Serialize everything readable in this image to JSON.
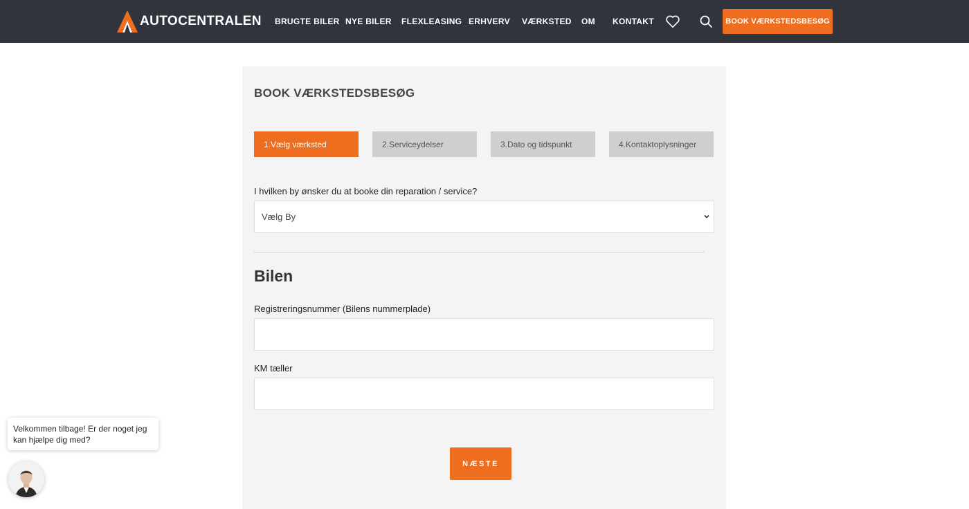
{
  "header": {
    "brand": "AUTOCENTRALEN",
    "nav": [
      "BRUGTE BILER",
      "NYE BILER",
      "FLEXLEASING",
      "ERHVERV",
      "VÆRKSTED",
      "OM",
      "KONTAKT"
    ],
    "icons": [
      "heart-icon",
      "search-icon"
    ],
    "cta_label": "BOOK VÆRKSTEDSBESØG"
  },
  "form": {
    "title": "BOOK VÆRKSTEDSBESØG",
    "steps": [
      {
        "label": "1.Vælg værksted",
        "active": true
      },
      {
        "label": "2.Serviceydelser",
        "active": false
      },
      {
        "label": "3.Dato og tidspunkt",
        "active": false
      },
      {
        "label": "4.Kontaktoplysninger",
        "active": false
      }
    ],
    "city_question": "I hvilken by ønsker du at booke din reparation / service?",
    "city_select_value": "Vælg By",
    "car_heading": "Bilen",
    "reg_label": "Registreringsnummer (Bilens nummerplade)",
    "reg_value": "",
    "km_label": "KM tæller",
    "km_value": "",
    "next_label": "NÆSTE"
  },
  "chat": {
    "message": "Velkommen tilbage! Er der noget jeg kan hjælpe dig med?",
    "avatar": "agent-avatar"
  },
  "colors": {
    "header_bg": "#30353d",
    "accent": "#ef6d1f",
    "panel_bg": "#f4f4f4",
    "step_inactive": "#cfcfcf"
  }
}
